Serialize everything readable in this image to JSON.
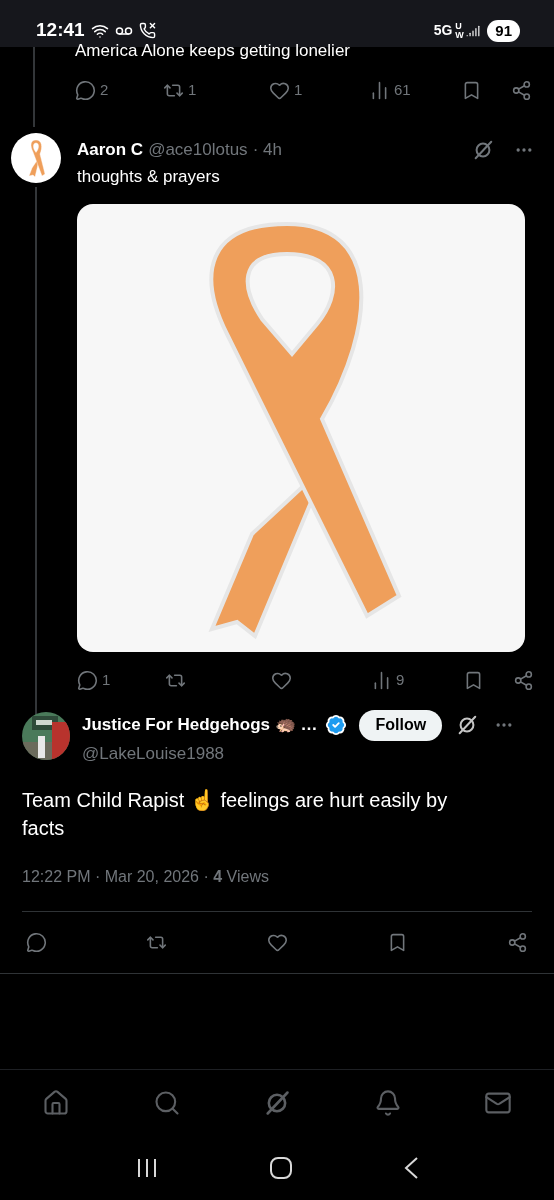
{
  "status_bar": {
    "time": "12:41",
    "network": "5G",
    "network_sub": "UW",
    "battery": "91"
  },
  "thread": [
    {
      "kind": "tail",
      "text": "America Alone keeps getting lonelier",
      "actions": [
        {
          "kind": "reply",
          "count": "2"
        },
        {
          "kind": "repost",
          "count": "1"
        },
        {
          "kind": "like",
          "count": "1"
        },
        {
          "kind": "views",
          "count": "61"
        },
        {
          "kind": "bookmark"
        },
        {
          "kind": "share"
        }
      ]
    },
    {
      "kind": "post",
      "name": "Aaron C",
      "handle": "@ace10lotus",
      "time": "· 4h",
      "text": "thoughts & prayers",
      "actions": [
        {
          "kind": "reply",
          "count": "1"
        },
        {
          "kind": "repost"
        },
        {
          "kind": "like"
        },
        {
          "kind": "views",
          "count": "9"
        },
        {
          "kind": "bookmark"
        },
        {
          "kind": "share"
        }
      ]
    }
  ],
  "focus_post": {
    "name": "Justice For Hedgehogs 🦔 …",
    "verified": true,
    "follow_button": "Follow",
    "handle": "@LakeLouise1988",
    "text": "Team Child Rapist ☝️ feelings are hurt easily by facts",
    "meta": "12:22 PM · Mar 20, 2026 · **4** Views",
    "actions": [
      {
        "kind": "reply"
      },
      {
        "kind": "repost"
      },
      {
        "kind": "like"
      },
      {
        "kind": "bookmark"
      },
      {
        "kind": "share"
      }
    ]
  },
  "bottom_nav": [
    {
      "kind": "home"
    },
    {
      "kind": "search"
    },
    {
      "kind": "grok"
    },
    {
      "kind": "notifications"
    },
    {
      "kind": "messages"
    }
  ]
}
